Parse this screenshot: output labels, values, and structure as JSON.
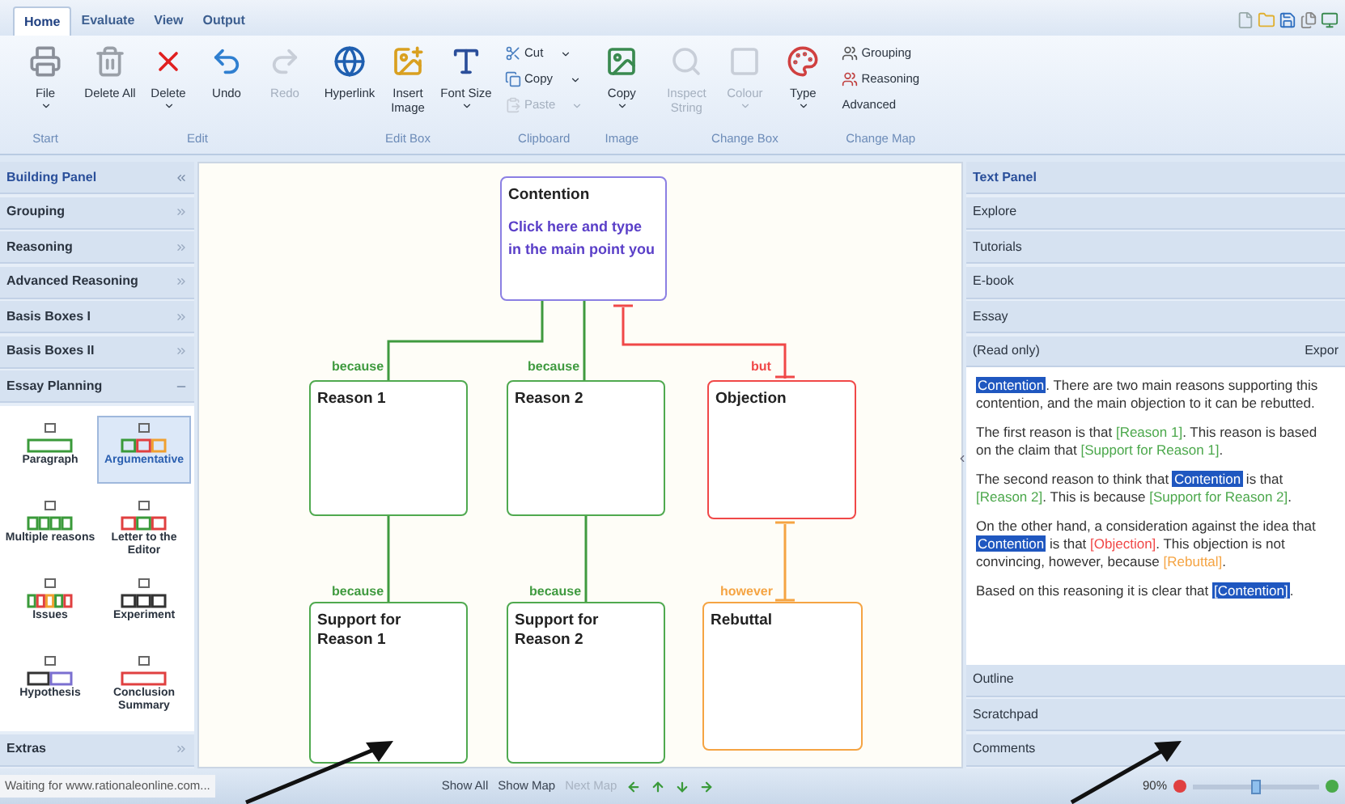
{
  "ribbon": {
    "tabs": [
      {
        "label": "Home",
        "selected": true
      },
      {
        "label": "Evaluate",
        "selected": false
      },
      {
        "label": "View",
        "selected": false
      },
      {
        "label": "Output",
        "selected": false
      }
    ],
    "groups": [
      {
        "label": "Start",
        "items": [
          {
            "kind": "large",
            "label": "File",
            "dropdown": true,
            "disabled": false
          }
        ]
      },
      {
        "label": "Edit",
        "items": [
          {
            "kind": "large",
            "label": "Delete All",
            "dropdown": false,
            "disabled": false
          },
          {
            "kind": "large",
            "label": "Delete",
            "dropdown": true,
            "disabled": false
          },
          {
            "kind": "large",
            "label": "Undo",
            "dropdown": false,
            "disabled": false
          },
          {
            "kind": "large",
            "label": "Redo",
            "dropdown": false,
            "disabled": true
          }
        ]
      },
      {
        "label": "Edit Box",
        "items": [
          {
            "kind": "large",
            "label": "Hyperlink",
            "dropdown": false,
            "disabled": false
          },
          {
            "kind": "large",
            "label": "Insert Image",
            "dropdown": false,
            "disabled": false
          },
          {
            "kind": "large",
            "label": "Font Size",
            "dropdown": true,
            "disabled": false
          }
        ]
      },
      {
        "label": "Clipboard",
        "items": [
          {
            "kind": "small",
            "label": "Cut",
            "dropdown": true,
            "disabled": false
          },
          {
            "kind": "small",
            "label": "Copy",
            "dropdown": true,
            "disabled": false
          },
          {
            "kind": "small",
            "label": "Paste",
            "dropdown": true,
            "disabled": true
          }
        ]
      },
      {
        "label": "Image",
        "items": [
          {
            "kind": "large",
            "label": "Copy",
            "dropdown": true,
            "disabled": false
          }
        ]
      },
      {
        "label": "Change Box",
        "items": [
          {
            "kind": "large",
            "label": "Inspect String",
            "dropdown": false,
            "disabled": true
          },
          {
            "kind": "large",
            "label": "Colour",
            "dropdown": true,
            "disabled": true
          },
          {
            "kind": "large",
            "label": "Type",
            "dropdown": true,
            "disabled": false
          }
        ]
      },
      {
        "label": "Change Map",
        "items": [
          {
            "kind": "small",
            "label": "Grouping",
            "dropdown": false,
            "disabled": false
          },
          {
            "kind": "small",
            "label": "Reasoning",
            "dropdown": false,
            "disabled": false
          },
          {
            "kind": "small",
            "label": "Advanced",
            "dropdown": false,
            "disabled": false
          }
        ]
      }
    ]
  },
  "building_panel": {
    "title": "Building Panel",
    "sections": [
      {
        "label": "Grouping",
        "expanded": false
      },
      {
        "label": "Reasoning",
        "expanded": false
      },
      {
        "label": "Advanced Reasoning",
        "expanded": false
      },
      {
        "label": "Basis Boxes I",
        "expanded": false
      },
      {
        "label": "Basis Boxes II",
        "expanded": false
      },
      {
        "label": "Essay Planning",
        "expanded": true,
        "templates": [
          {
            "label": "Paragraph",
            "selected": false
          },
          {
            "label": "Argumentative",
            "selected": true
          },
          {
            "label": "Multiple reasons",
            "selected": false
          },
          {
            "label": "Letter to the Editor",
            "selected": false
          },
          {
            "label": "Issues",
            "selected": false
          },
          {
            "label": "Experiment",
            "selected": false
          },
          {
            "label": "Hypothesis",
            "selected": false
          },
          {
            "label": "Conclusion Summary",
            "selected": false
          }
        ]
      },
      {
        "label": "Extras",
        "expanded": false
      }
    ]
  },
  "map": {
    "nodes": [
      {
        "title": "Contention",
        "body_lines": [
          "Click here and type",
          "in the main point you"
        ],
        "color": "#8b7fe3"
      },
      {
        "title": "Reason 1",
        "color": "#4fa94f"
      },
      {
        "title": "Reason 2",
        "color": "#4fa94f"
      },
      {
        "title": "Objection",
        "color": "#f04848"
      },
      {
        "title": "Support for Reason 1",
        "color": "#4fa94f"
      },
      {
        "title": "Support for Reason 2",
        "color": "#4fa94f"
      },
      {
        "title": "Rebuttal",
        "color": "#f5a443"
      }
    ],
    "links": [
      {
        "label": "because",
        "color": "#3f9a3f"
      },
      {
        "label": "because",
        "color": "#3f9a3f"
      },
      {
        "label": "but",
        "color": "#f04848"
      },
      {
        "label": "because",
        "color": "#3f9a3f"
      },
      {
        "label": "because",
        "color": "#3f9a3f"
      },
      {
        "label": "however",
        "color": "#f5a443"
      }
    ]
  },
  "text_panel": {
    "title": "Text Panel",
    "sections_top": [
      "Explore",
      "Tutorials",
      "E-book",
      "Essay"
    ],
    "mode_label": "(Read only)",
    "export_label": "Expor",
    "paragraphs": [
      [
        {
          "kind": "contention",
          "text": "Contention"
        },
        {
          "kind": "plain",
          "text": ". There are two main reasons supporting this contention, and the main objection to it can be rebutted."
        }
      ],
      [
        {
          "kind": "plain",
          "text": "The first reason is that "
        },
        {
          "kind": "reason",
          "text": "[Reason 1]"
        },
        {
          "kind": "plain",
          "text": ". This reason is based on the claim that "
        },
        {
          "kind": "reason",
          "text": "[Support for Reason 1]"
        },
        {
          "kind": "plain",
          "text": "."
        }
      ],
      [
        {
          "kind": "plain",
          "text": "The second reason to think that "
        },
        {
          "kind": "contention",
          "text": "Contention"
        },
        {
          "kind": "plain",
          "text": " is that "
        },
        {
          "kind": "reason",
          "text": "[Reason 2]"
        },
        {
          "kind": "plain",
          "text": ". This is because "
        },
        {
          "kind": "reason",
          "text": "[Support for Reason 2]"
        },
        {
          "kind": "plain",
          "text": "."
        }
      ],
      [
        {
          "kind": "plain",
          "text": "On the other hand, a consideration against the idea that "
        },
        {
          "kind": "contention",
          "text": "Contention"
        },
        {
          "kind": "plain",
          "text": " is that "
        },
        {
          "kind": "objection",
          "text": "[Objection]"
        },
        {
          "kind": "plain",
          "text": ". This objection is not convincing, however, because "
        },
        {
          "kind": "rebuttal",
          "text": "[Rebuttal]"
        },
        {
          "kind": "plain",
          "text": "."
        }
      ],
      [
        {
          "kind": "plain",
          "text": "Based on this reasoning it is clear that "
        },
        {
          "kind": "contention",
          "text": "[Contention]"
        },
        {
          "kind": "plain",
          "text": "."
        }
      ]
    ],
    "sections_bottom": [
      "Outline",
      "Scratchpad",
      "Comments"
    ]
  },
  "status_bar": {
    "message": "Waiting for www.rationaleonline.com...",
    "buttons": [
      {
        "label": "Show All",
        "disabled": false
      },
      {
        "label": "Show Map",
        "disabled": false
      },
      {
        "label": "Next Map",
        "disabled": true
      }
    ],
    "zoom": {
      "label": "90%",
      "level": 0.5
    }
  }
}
